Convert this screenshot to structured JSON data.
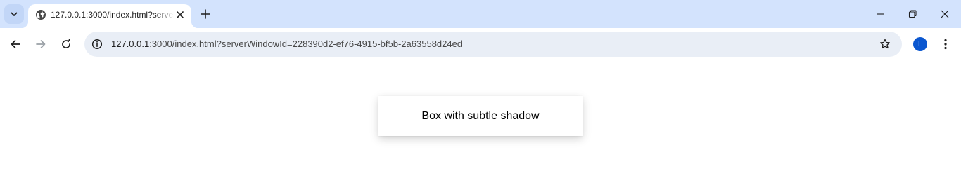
{
  "browser": {
    "tab": {
      "title": "127.0.0.1:3000/index.html?serverWindowId=228390d2-ef76-4915-bf5b-2a63558d24ed",
      "favicon": "globe-icon"
    },
    "toolbar": {
      "url_host": "127.0.0.1",
      "url_rest": ":3000/index.html?serverWindowId=228390d2-ef76-4915-bf5b-2a63558d24ed",
      "profile_initial": "L"
    },
    "icons": {
      "tab_search": "chevron-down-icon",
      "tab_close": "close-icon",
      "new_tab": "plus-icon",
      "minimize": "minimize-icon",
      "restore": "restore-icon",
      "close_window": "close-icon",
      "back": "arrow-left-icon",
      "forward": "arrow-right-icon",
      "reload": "reload-icon",
      "site_info": "info-icon",
      "bookmark": "star-icon",
      "menu": "more-vert-icon"
    },
    "colors": {
      "tabstrip_bg": "#d3e3fd",
      "omnibox_bg": "#e9eef6",
      "avatar_bg": "#0b57d0"
    }
  },
  "page": {
    "box_text": "Box with subtle shadow"
  }
}
